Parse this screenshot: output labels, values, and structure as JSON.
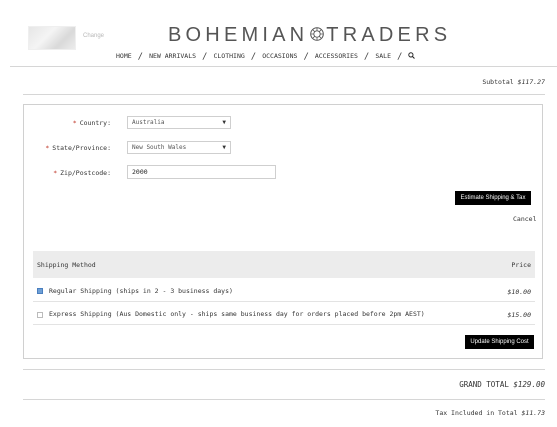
{
  "header": {
    "thumbnail_label": "Change",
    "brand_left": "BOHEMIAN",
    "brand_right": "TRADERS",
    "nav": [
      "HOME",
      "NEW ARRIVALS",
      "CLOTHING",
      "OCCASIONS",
      "ACCESSORIES",
      "SALE"
    ],
    "nav_separator": "/",
    "search_icon": "search-icon"
  },
  "summary": {
    "subtotal_label": "Subtotal",
    "subtotal_value": "$117.27"
  },
  "estimate": {
    "required_mark": "*",
    "country_label": "Country:",
    "country_value": "Australia",
    "state_label": "State/Province:",
    "state_value": "New South Wales",
    "zip_label": "Zip/Postcode:",
    "zip_value": "2000",
    "estimate_button": "Estimate Shipping & Tax",
    "cancel_label": "Cancel"
  },
  "shipping": {
    "method_header": "Shipping Method",
    "price_header": "Price",
    "options": [
      {
        "label": "Regular Shipping (ships in 2 - 3 business days)",
        "price": "$10.00",
        "selected": true
      },
      {
        "label": "Express Shipping (Aus Domestic only - ships same business day for orders placed before 2pm AEST)",
        "price": "$15.00",
        "selected": false
      }
    ],
    "update_button": "Update Shipping Cost"
  },
  "totals": {
    "grand_total_label": "GRAND TOTAL",
    "grand_total_value": "$129.00",
    "tax_label": "Tax Included in Total",
    "tax_value": "$11.73"
  },
  "colors": {
    "required": "#c0392b",
    "button_bg": "#000000",
    "radio_selected": "#6e9fd6",
    "table_header_bg": "#ececec"
  }
}
